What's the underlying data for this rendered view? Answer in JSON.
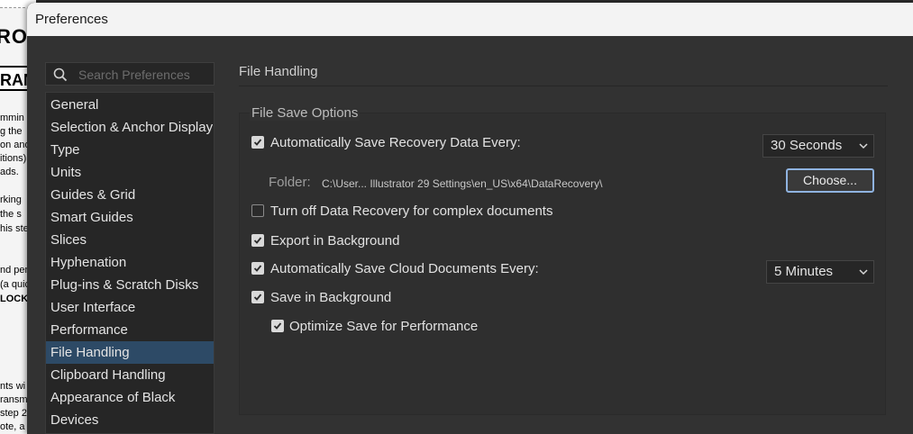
{
  "background_document": {
    "heading": "RO",
    "boxed_heading": "RAM",
    "lines": [
      "mmin",
      "g the",
      "on and",
      "itions)",
      "ads.",
      "rking",
      "the s",
      "his ste",
      "nd pen",
      "(a quic",
      "LOCK",
      "nts wi",
      "ransm",
      "step 2",
      "ote, a"
    ]
  },
  "dialog": {
    "title": "Preferences"
  },
  "search": {
    "placeholder": "Search Preferences",
    "icon": "search-icon"
  },
  "nav": {
    "selected": "File Handling",
    "items": [
      "General",
      "Selection & Anchor Display",
      "Type",
      "Units",
      "Guides & Grid",
      "Smart Guides",
      "Slices",
      "Hyphenation",
      "Plug-ins & Scratch Disks",
      "User Interface",
      "Performance",
      "File Handling",
      "Clipboard Handling",
      "Appearance of Black",
      "Devices"
    ]
  },
  "panel": {
    "section_title": "File Handling",
    "group_title": "File Save Options",
    "auto_save": {
      "label": "Automatically Save Recovery Data Every:",
      "checked": true,
      "interval": "30 Seconds"
    },
    "folder": {
      "label": "Folder:",
      "path": "C:\\User... Illustrator 29 Settings\\en_US\\x64\\DataRecovery\\",
      "choose_label": "Choose..."
    },
    "turn_off_recovery": {
      "label": "Turn off Data Recovery for complex documents",
      "checked": false
    },
    "export_background": {
      "label": "Export in Background",
      "checked": true
    },
    "auto_save_cloud": {
      "label": "Automatically Save Cloud Documents Every:",
      "checked": true,
      "interval": "5 Minutes"
    },
    "save_background": {
      "label": "Save in Background",
      "checked": true
    },
    "optimize_save": {
      "label": "Optimize Save for Performance",
      "checked": true
    }
  },
  "colors": {
    "selection": "#2d4a66",
    "focus_ring": "#8fb3e0",
    "dialog_bg": "#323232"
  }
}
